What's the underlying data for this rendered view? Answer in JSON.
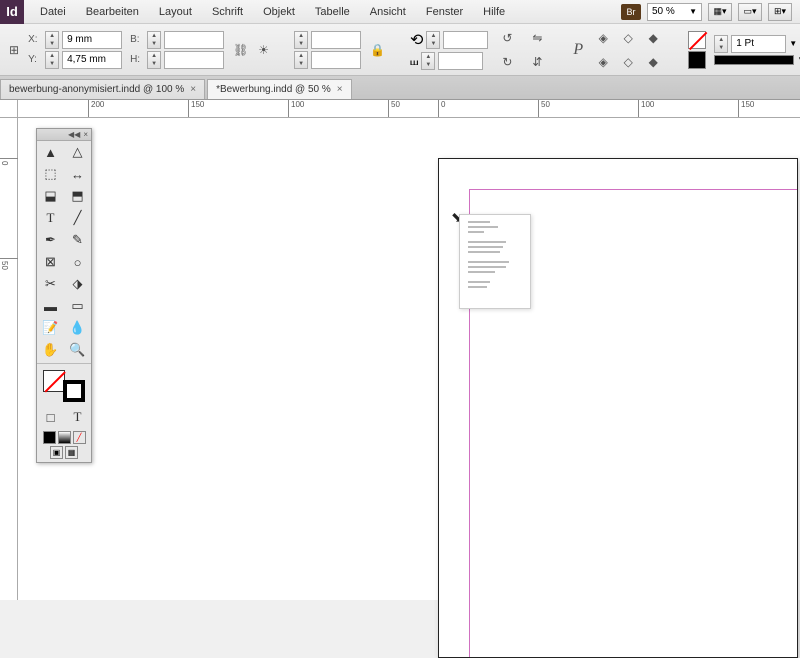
{
  "app": {
    "icon_text": "Id"
  },
  "menu": [
    "Datei",
    "Bearbeiten",
    "Layout",
    "Schrift",
    "Objekt",
    "Tabelle",
    "Ansicht",
    "Fenster",
    "Hilfe"
  ],
  "menu_right": {
    "br": "Br",
    "zoom": "50 %"
  },
  "control": {
    "x": {
      "label": "X:",
      "value": "9 mm"
    },
    "y": {
      "label": "Y:",
      "value": "4,75 mm"
    },
    "b": {
      "label": "B:",
      "value": ""
    },
    "h": {
      "label": "H:",
      "value": ""
    },
    "stroke": {
      "weight": "1 Pt"
    }
  },
  "tabs": [
    {
      "label": "bewerbung-anonymisiert.indd @ 100 %",
      "active": false
    },
    {
      "label": "*Bewerbung.indd @ 50 %",
      "active": true
    }
  ],
  "ruler_h": [
    {
      "pos": 70,
      "label": "200"
    },
    {
      "pos": 170,
      "label": "150"
    },
    {
      "pos": 270,
      "label": "100"
    },
    {
      "pos": 370,
      "label": "50"
    },
    {
      "pos": 420,
      "label": "0"
    },
    {
      "pos": 520,
      "label": "50"
    },
    {
      "pos": 620,
      "label": "100"
    },
    {
      "pos": 720,
      "label": "150"
    }
  ],
  "ruler_v": [
    {
      "pos": 40,
      "label": "0"
    },
    {
      "pos": 140,
      "label": "50"
    }
  ]
}
